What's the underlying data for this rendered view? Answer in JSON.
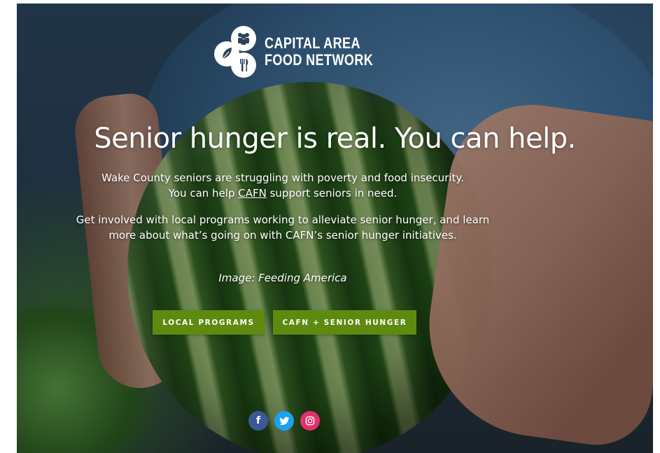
{
  "logo": {
    "line1": "CAPITAL AREA",
    "line2": "FOOD NETWORK"
  },
  "hero": {
    "headline": "Senior hunger is real. You can help.",
    "para1_before": "Wake County seniors are struggling with poverty and food insecurity. You can help ",
    "para1_link": "CAFN",
    "para1_after": " support seniors in need.",
    "para2": "Get involved with local programs working to alleviate senior hunger, and learn more about what’s going on with CAFN’s senior hunger initiatives.",
    "image_credit": "Image: Feeding America"
  },
  "buttons": {
    "local_programs": "LOCAL PROGRAMS",
    "cafn_senior_hunger": "CAFN + SENIOR HUNGER",
    "color": "#5e8a0f"
  },
  "social": [
    {
      "name": "facebook-icon",
      "glyph": "f",
      "color": "#3b5998"
    },
    {
      "name": "twitter-icon",
      "glyph": "🐦",
      "color": "#1da1f2"
    },
    {
      "name": "instagram-icon",
      "glyph": "◎",
      "color": "#e1306c"
    }
  ]
}
